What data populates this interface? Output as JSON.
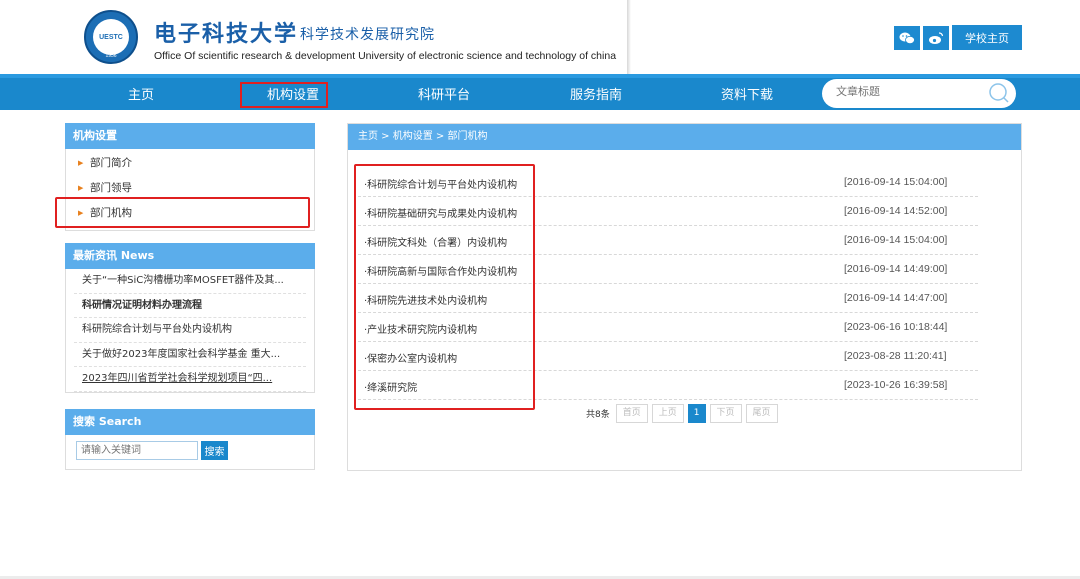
{
  "header": {
    "logo_text": "UESTC",
    "logo_year": "1956",
    "brand_cn": "电子科技大学",
    "brand_sub": "科学技术发展研究院",
    "brand_en": "Office Of scientific research & development University of electronic science and technology of china",
    "school_home": "学校主页"
  },
  "nav": {
    "items": [
      "主页",
      "机构设置",
      "科研平台",
      "服务指南",
      "资料下载"
    ],
    "search_placeholder": "文章标题"
  },
  "sidebar": {
    "section_title": "机构设置",
    "menu": [
      "部门简介",
      "部门领导",
      "部门机构"
    ],
    "news_title": "最新资讯   News",
    "news": [
      "关于“一种SiC沟槽栅功率MOSFET器件及其...",
      "科研情况证明材料办理流程",
      "科研院综合计划与平台处内设机构",
      "关于做好2023年度国家社会科学基金 重大...",
      "2023年四川省哲学社会科学规划项目“四..."
    ],
    "search_title": "搜索   Search",
    "search_placeholder": "请输入关键词",
    "search_button": "搜索"
  },
  "content": {
    "breadcrumb": "主页 > 机构设置 > 部门机构",
    "rows": [
      {
        "title": "·科研院综合计划与平台处内设机构",
        "date": "[2016-09-14 15:04:00]"
      },
      {
        "title": "·科研院基础研究与成果处内设机构",
        "date": "[2016-09-14 14:52:00]"
      },
      {
        "title": "·科研院文科处（合署）内设机构",
        "date": "[2016-09-14 15:04:00]"
      },
      {
        "title": "·科研院高新与国际合作处内设机构",
        "date": "[2016-09-14 14:49:00]"
      },
      {
        "title": "·科研院先进技术处内设机构",
        "date": "[2016-09-14 14:47:00]"
      },
      {
        "title": "·产业技术研究院内设机构",
        "date": "[2023-06-16 10:18:44]"
      },
      {
        "title": "·保密办公室内设机构",
        "date": "[2023-08-28 11:20:41]"
      },
      {
        "title": "·绛溪研究院",
        "date": "[2023-10-26 16:39:58]"
      }
    ],
    "pager": {
      "total": "共8条",
      "first": "首页",
      "prev": "上页",
      "current": "1",
      "next": "下页",
      "last": "尾页"
    }
  },
  "colors": {
    "nav_blue": "#1a88cc",
    "panel_blue": "#5badeb",
    "highlight_red": "#e02020"
  }
}
